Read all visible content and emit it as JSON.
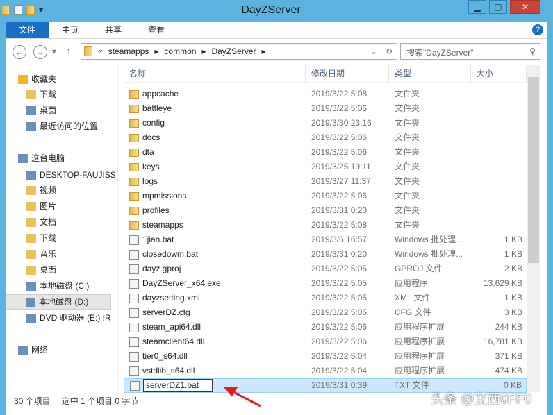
{
  "window": {
    "title": "DayZServer"
  },
  "ribbon": {
    "tabs": [
      "文件",
      "主页",
      "共享",
      "查看"
    ]
  },
  "address": {
    "path": [
      "«",
      "steamapps",
      "common",
      "DayZServer"
    ],
    "search_placeholder": "搜索\"DayZServer\""
  },
  "nav": {
    "items": [
      {
        "label": "收藏夹",
        "icon": "star-icon",
        "indent": 0
      },
      {
        "label": "下载",
        "icon": "downloads-folder-icon",
        "indent": 1
      },
      {
        "label": "桌面",
        "icon": "desktop-icon",
        "indent": 1
      },
      {
        "label": "最近访问的位置",
        "icon": "recent-icon",
        "indent": 1
      },
      {
        "label": "这台电脑",
        "icon": "computer-icon",
        "indent": 0
      },
      {
        "label": "DESKTOP-FAUJISS",
        "icon": "network-pc-icon",
        "indent": 1
      },
      {
        "label": "视频",
        "icon": "videos-folder-icon",
        "indent": 1
      },
      {
        "label": "图片",
        "icon": "pictures-folder-icon",
        "indent": 1
      },
      {
        "label": "文档",
        "icon": "documents-folder-icon",
        "indent": 1
      },
      {
        "label": "下载",
        "icon": "downloads-folder-icon",
        "indent": 1
      },
      {
        "label": "音乐",
        "icon": "music-folder-icon",
        "indent": 1
      },
      {
        "label": "桌面",
        "icon": "desktop-folder-icon",
        "indent": 1
      },
      {
        "label": "本地磁盘 (C:)",
        "icon": "drive-c-icon",
        "indent": 1
      },
      {
        "label": "本地磁盘 (D:)",
        "icon": "drive-icon",
        "indent": 1,
        "selected": true
      },
      {
        "label": "DVD 驱动器 (E:) IR",
        "icon": "dvd-icon",
        "indent": 1
      },
      {
        "label": "网络",
        "icon": "network-icon",
        "indent": 0
      }
    ]
  },
  "columns": [
    "名称",
    "修改日期",
    "类型",
    "大小"
  ],
  "files": [
    {
      "name": "appcache",
      "date": "2019/3/22 5:08",
      "type": "文件夹",
      "size": "",
      "folder": true
    },
    {
      "name": "battleye",
      "date": "2019/3/22 5:06",
      "type": "文件夹",
      "size": "",
      "folder": true
    },
    {
      "name": "config",
      "date": "2019/3/30 23:16",
      "type": "文件夹",
      "size": "",
      "folder": true
    },
    {
      "name": "docs",
      "date": "2019/3/22 5:06",
      "type": "文件夹",
      "size": "",
      "folder": true
    },
    {
      "name": "dta",
      "date": "2019/3/22 5:06",
      "type": "文件夹",
      "size": "",
      "folder": true
    },
    {
      "name": "keys",
      "date": "2019/3/25 19:11",
      "type": "文件夹",
      "size": "",
      "folder": true
    },
    {
      "name": "logs",
      "date": "2019/3/27 11:37",
      "type": "文件夹",
      "size": "",
      "folder": true
    },
    {
      "name": "mpmissions",
      "date": "2019/3/22 5:06",
      "type": "文件夹",
      "size": "",
      "folder": true
    },
    {
      "name": "profiles",
      "date": "2019/3/31 0:20",
      "type": "文件夹",
      "size": "",
      "folder": true
    },
    {
      "name": "steamapps",
      "date": "2019/3/22 5:08",
      "type": "文件夹",
      "size": "",
      "folder": true
    },
    {
      "name": "1jian.bat",
      "date": "2019/3/6 16:57",
      "type": "Windows 批处理...",
      "size": "1 KB"
    },
    {
      "name": "closedowm.bat",
      "date": "2019/3/31 0:20",
      "type": "Windows 批处理...",
      "size": "1 KB"
    },
    {
      "name": "dayz.gproj",
      "date": "2019/3/22 5:05",
      "type": "GPROJ 文件",
      "size": "2 KB"
    },
    {
      "name": "DayZServer_x64.exe",
      "date": "2019/3/22 5:05",
      "type": "应用程序",
      "size": "13,629 KB"
    },
    {
      "name": "dayzsetting.xml",
      "date": "2019/3/22 5:05",
      "type": "XML 文件",
      "size": "1 KB"
    },
    {
      "name": "serverDZ.cfg",
      "date": "2019/3/22 5:05",
      "type": "CFG 文件",
      "size": "3 KB"
    },
    {
      "name": "steam_api64.dll",
      "date": "2019/3/22 5:06",
      "type": "应用程序扩展",
      "size": "244 KB"
    },
    {
      "name": "steamclient64.dll",
      "date": "2019/3/22 5:06",
      "type": "应用程序扩展",
      "size": "16,781 KB"
    },
    {
      "name": "tier0_s64.dll",
      "date": "2019/3/22 5:04",
      "type": "应用程序扩展",
      "size": "371 KB"
    },
    {
      "name": "vstdlib_s64.dll",
      "date": "2019/3/22 5:04",
      "type": "应用程序扩展",
      "size": "474 KB"
    },
    {
      "name": "serverDZ1.bat",
      "date": "2019/3/31 0:39",
      "type": "TXT 文件",
      "size": "0 KB",
      "selected": true,
      "renaming": true
    }
  ],
  "status": {
    "count": "30 个项目",
    "selected": "选中 1 个项目 0 字节"
  },
  "watermark": "头条 @艾西0FF0"
}
